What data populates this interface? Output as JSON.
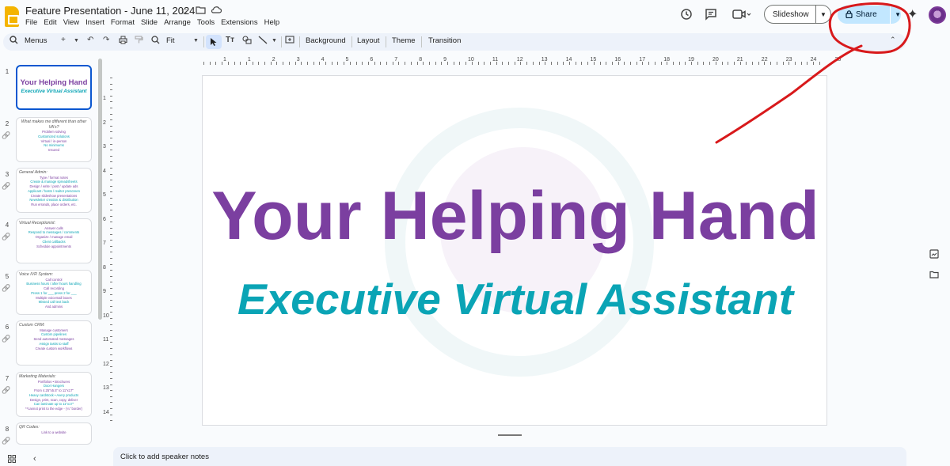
{
  "app": {
    "title": "Feature Presentation - June 11, 2024",
    "menus": [
      "File",
      "Edit",
      "View",
      "Insert",
      "Format",
      "Slide",
      "Arrange",
      "Tools",
      "Extensions",
      "Help"
    ]
  },
  "header": {
    "slideshow_label": "Slideshow",
    "share_label": "Share",
    "share_color": "#c2e7ff"
  },
  "toolbar": {
    "menus_label": "Menus",
    "zoom_value": "Fit",
    "background_label": "Background",
    "layout_label": "Layout",
    "theme_label": "Theme",
    "transition_label": "Transition"
  },
  "ruler": {
    "h_ticks": [
      "1",
      "1",
      "2",
      "3",
      "4",
      "5",
      "6",
      "7",
      "8",
      "9",
      "10",
      "11",
      "12",
      "13",
      "14",
      "15",
      "16",
      "17",
      "18",
      "19",
      "20",
      "21",
      "22",
      "23",
      "24",
      "25"
    ],
    "v_ticks": [
      "1",
      "2",
      "3",
      "4",
      "5",
      "6",
      "7",
      "8",
      "9",
      "10",
      "11",
      "12",
      "13",
      "14"
    ]
  },
  "slides": [
    {
      "num": "1",
      "title": "Your Helping Hand",
      "subtitle": "Executive Virtual Assistant",
      "lines": []
    },
    {
      "num": "2",
      "title": "What makes me different than other VA's?",
      "lines": [
        "Problem solving",
        "Customized solutions",
        "Virtual / in-person",
        "No minimums",
        "Insured"
      ]
    },
    {
      "num": "3",
      "title": "General Admin:",
      "lines": [
        "Type / format notes",
        "Create & manage spreadsheets",
        "Design / write / post / update ads",
        "Applicant / hosts / realtor prescreen",
        "Create slideshow presentations",
        "Newsletter creation & distribution",
        "Run errands, place orders, etc."
      ]
    },
    {
      "num": "4",
      "title": "Virtual Receptionist:",
      "lines": [
        "Answer calls",
        "Respond to messages / comments",
        "Organize / manage email",
        "Client callbacks",
        "Schedule appointments"
      ]
    },
    {
      "num": "5",
      "title": "Voice IVR System:",
      "lines": [
        "Call control",
        "Business hours / after hours handling",
        "Call recording",
        "Press 1 for ___ press 2 for ___",
        "Multiple voicemail boxes",
        "Missed call text back",
        "And admins"
      ]
    },
    {
      "num": "6",
      "title": "Custom CRM:",
      "lines": [
        "Manage customers",
        "Custom pipelines",
        "Send automated messages",
        "Assign tasks to staff",
        "Create custom workflows"
      ]
    },
    {
      "num": "7",
      "title": "Marketing Materials:",
      "lines": [
        "Portfolios • Brochures",
        "Door Hangers",
        "From 4.25\"x5.5\" to 11\"x17\"",
        "Heavy cardstock • Avery products",
        "Design, print, scan, copy, deliver",
        "Can laminate up to 11\"x17\"",
        "**cannot print to the edge - (¼\" border)"
      ]
    },
    {
      "num": "8",
      "title": "QR Codes:",
      "lines": [
        "Link to a website"
      ]
    }
  ],
  "slide_main": {
    "title": "Your Helping Hand",
    "subtitle": "Executive Virtual Assistant",
    "title_color": "#7b3fa0",
    "subtitle_color": "#0aa4b5"
  },
  "notes": {
    "placeholder": "Click to add speaker notes"
  },
  "annotation": {
    "color": "#d8191b"
  }
}
